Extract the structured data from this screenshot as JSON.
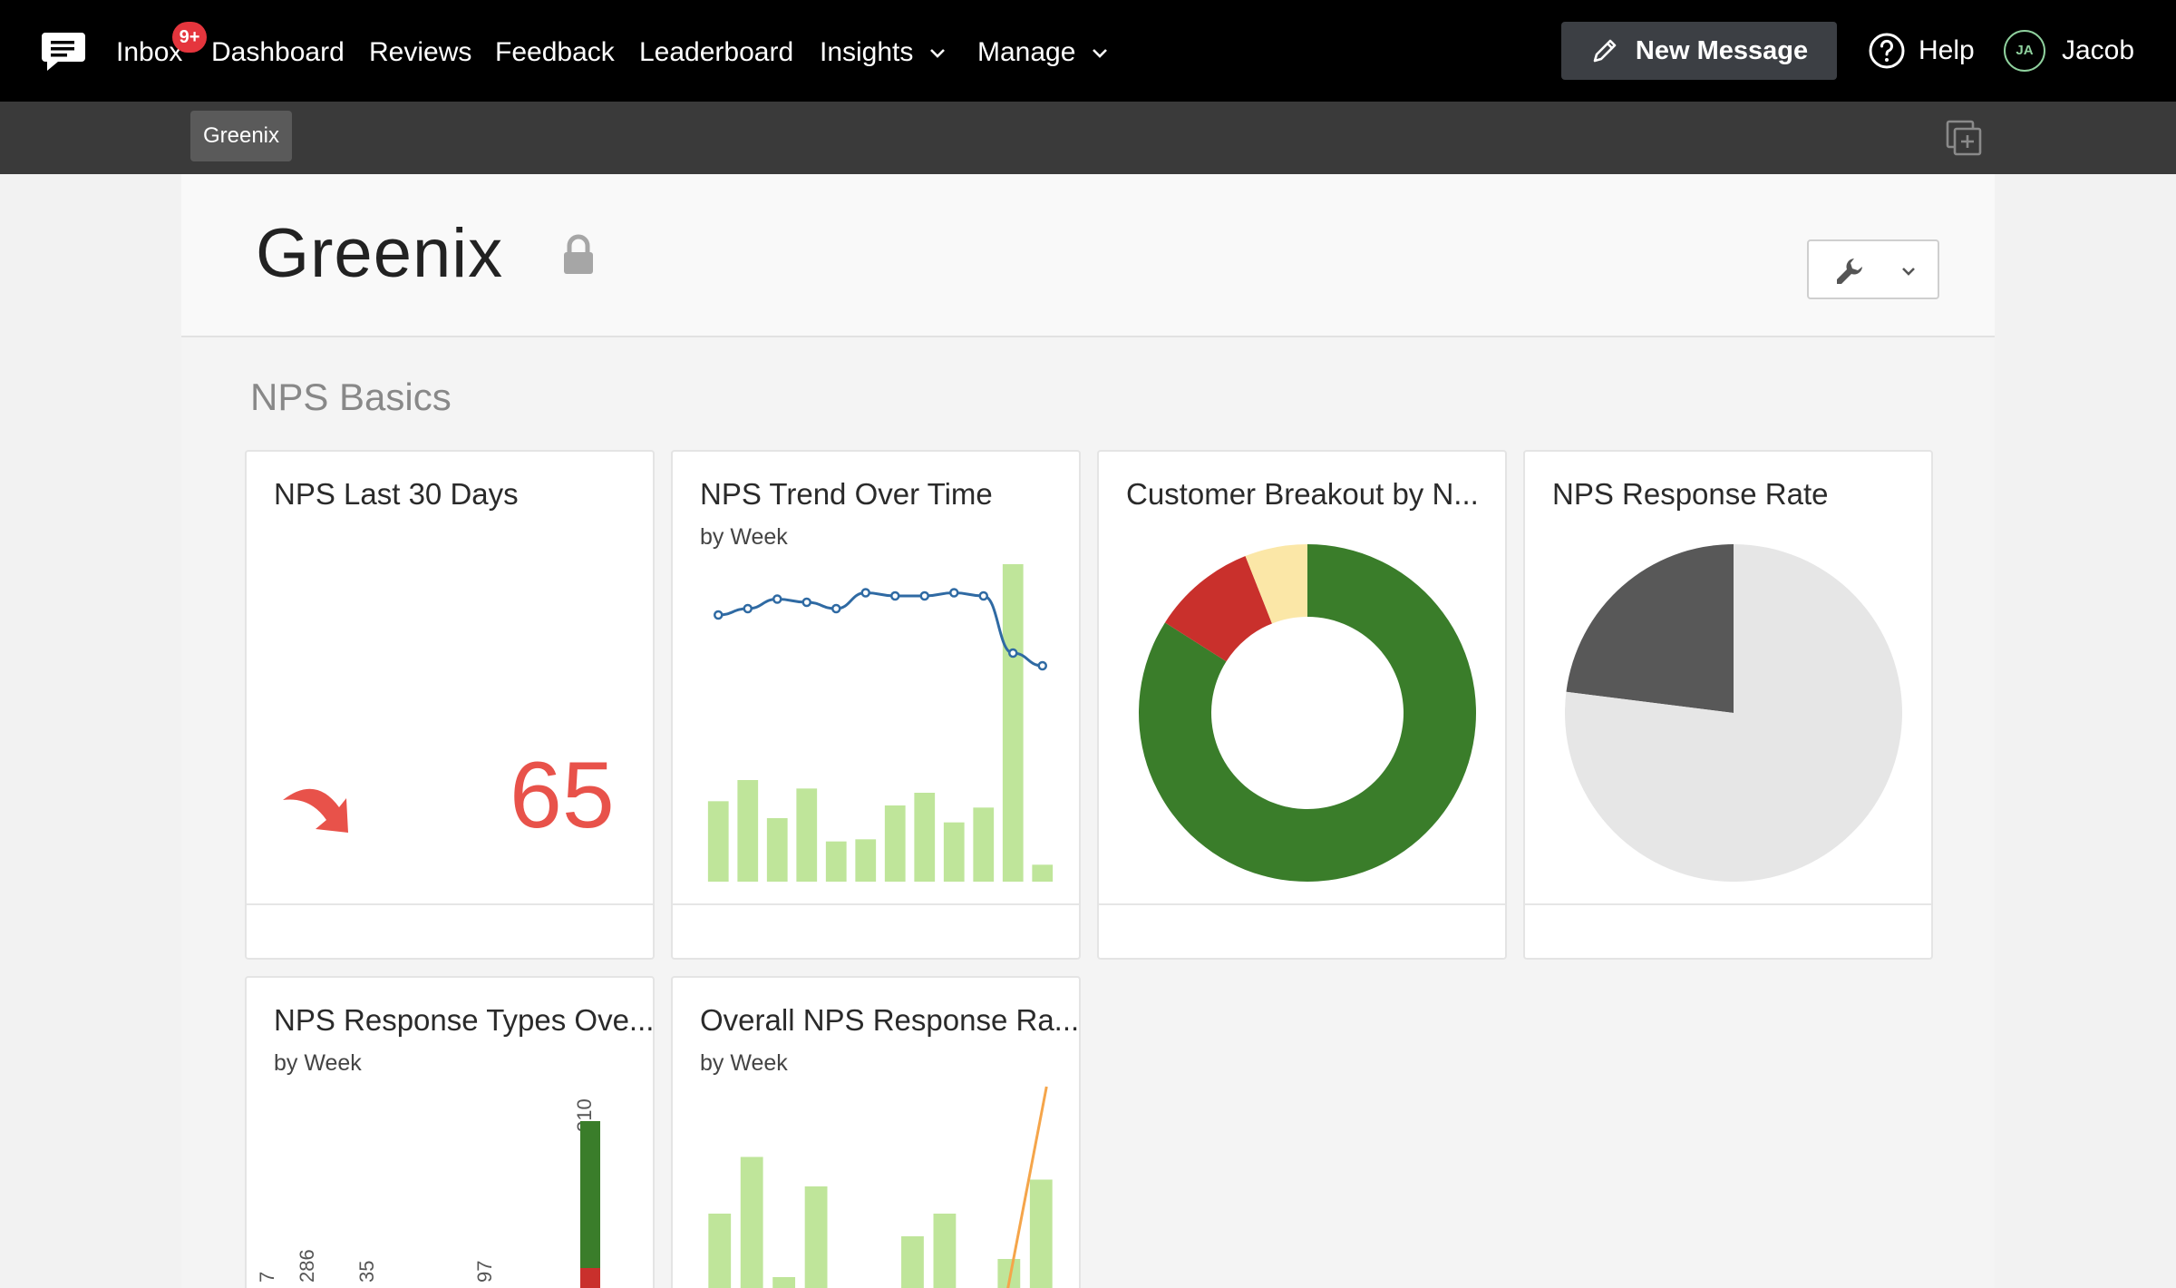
{
  "nav": {
    "inbox": "Inbox",
    "inbox_badge": "9+",
    "dashboard": "Dashboard",
    "reviews": "Reviews",
    "feedback": "Feedback",
    "leaderboard": "Leaderboard",
    "insights": "Insights",
    "manage": "Manage",
    "new_message": "New Message",
    "help": "Help",
    "user_initials": "JA",
    "user_name": "Jacob"
  },
  "subnav": {
    "workspace_tab": "Greenix"
  },
  "page": {
    "title": "Greenix",
    "section": "NPS Basics"
  },
  "cards": {
    "nps_last_30": {
      "title": "NPS Last 30 Days",
      "value": "65"
    },
    "nps_trend": {
      "title": "NPS Trend Over Time",
      "subtitle": "by Week"
    },
    "customer_breakout": {
      "title": "Customer Breakout by N..."
    },
    "response_rate": {
      "title": "NPS Response Rate"
    },
    "response_types": {
      "title": "NPS Response Types Ove...",
      "subtitle": "by Week"
    },
    "overall_response_rate": {
      "title": "Overall NPS Response Ra...",
      "subtitle": "by Week"
    }
  },
  "chart_data": [
    {
      "id": "nps_trend",
      "type": "bar",
      "bar_values": [
        38,
        48,
        30,
        44,
        19,
        20,
        36,
        42,
        28,
        35,
        150,
        8
      ],
      "line_values": [
        84,
        86,
        89,
        88,
        86,
        91,
        90,
        90,
        91,
        90,
        72,
        68
      ],
      "colors": {
        "bars": "#bfe59a",
        "line": "#2f6aa3"
      }
    },
    {
      "id": "customer_breakout",
      "type": "pie",
      "donut": true,
      "slices": [
        {
          "name": "Promoters",
          "value": 84,
          "color": "#3a7d2a"
        },
        {
          "name": "Detractors",
          "value": 10,
          "color": "#c9302c"
        },
        {
          "name": "Passives",
          "value": 6,
          "color": "#fbe7a7"
        }
      ]
    },
    {
      "id": "response_rate",
      "type": "pie",
      "slices": [
        {
          "name": "Responded",
          "value": 23,
          "color": "#585858"
        },
        {
          "name": "No response",
          "value": 77,
          "color": "#e6e6e6"
        }
      ]
    },
    {
      "id": "response_types",
      "type": "bar",
      "stacked": true,
      "tick_labels": [
        "7",
        "286",
        "35",
        "97",
        "310"
      ],
      "colors": {
        "promoters": "#3a7d2a",
        "detractors": "#c9302c"
      }
    },
    {
      "id": "overall_response_rate",
      "type": "bar",
      "bar_values": [
        40,
        65,
        12,
        52,
        0,
        0,
        30,
        40,
        5,
        20,
        55
      ],
      "line_values": [
        0,
        0,
        0,
        0,
        0,
        0,
        0,
        0,
        0,
        10,
        120
      ],
      "colors": {
        "bars": "#bfe59a",
        "line": "#f5a54a"
      }
    }
  ]
}
